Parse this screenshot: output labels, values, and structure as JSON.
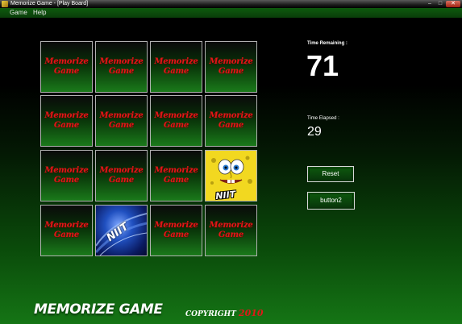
{
  "window": {
    "title": "Memorize Game - [Play Board]",
    "controls": {
      "minimize": "–",
      "maximize": "□",
      "close": "✕"
    }
  },
  "menu": {
    "items": [
      "Game",
      "Help"
    ]
  },
  "card_back": {
    "line1": "Memorize",
    "line2": "Game"
  },
  "cards": [
    {
      "state": "hidden"
    },
    {
      "state": "hidden"
    },
    {
      "state": "hidden"
    },
    {
      "state": "hidden"
    },
    {
      "state": "hidden"
    },
    {
      "state": "hidden"
    },
    {
      "state": "hidden"
    },
    {
      "state": "hidden"
    },
    {
      "state": "hidden"
    },
    {
      "state": "hidden"
    },
    {
      "state": "hidden"
    },
    {
      "state": "revealed",
      "face": "sponge",
      "caption": "NIIT"
    },
    {
      "state": "hidden"
    },
    {
      "state": "revealed",
      "face": "niit",
      "caption": "NIIT"
    },
    {
      "state": "hidden"
    },
    {
      "state": "hidden"
    }
  ],
  "timer": {
    "remaining_label": "Time Remaining :",
    "remaining_value": "71",
    "elapsed_label": "Time Elapsed :",
    "elapsed_value": "29"
  },
  "buttons": {
    "reset": "Reset",
    "button2": "button2"
  },
  "footer": {
    "brand": "MEMORIZE GAME",
    "copyright": "COPYRIGHT",
    "year": "2010"
  },
  "colors": {
    "accent_red": "#e01818",
    "board_green": "#157515",
    "background": "#000000"
  }
}
